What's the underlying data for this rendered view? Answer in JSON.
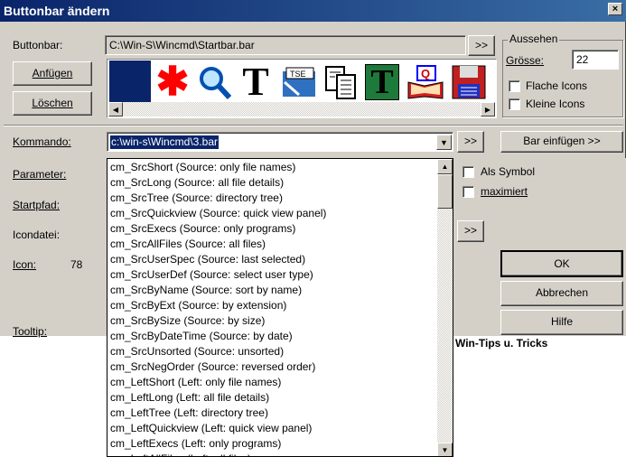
{
  "window": {
    "title": "Buttonbar ändern",
    "close": "×"
  },
  "buttonbar": {
    "label": "Buttonbar:",
    "path": "C:\\Win-S\\Wincmd\\Startbar.bar",
    "browse": ">>"
  },
  "buttons": {
    "append": "Anfügen",
    "delete": "Löschen",
    "ok": "OK",
    "cancel": "Abbrechen",
    "help": "Hilfe",
    "insert_bar": "Bar einfügen >>",
    "cmd_browse": ">>",
    "icon_browse": ">>"
  },
  "appearance": {
    "group": "Aussehen",
    "size_label": "Grösse:",
    "size_value": "22",
    "flat_icons": "Flache Icons",
    "small_icons": "Kleine Icons"
  },
  "fields": {
    "command_label": "Kommando:",
    "command_value": "c:\\win-s\\Wincmd\\3.bar",
    "parameter_label": "Parameter:",
    "startpath_label": "Startpfad:",
    "iconfile_label": "Icondatei:",
    "icon_label": "Icon:",
    "icon_number": "78",
    "tooltip_label": "Tooltip:"
  },
  "options": {
    "as_symbol": "Als Symbol",
    "maximized": "maximiert"
  },
  "background_text": "Win-Tips u. Tricks",
  "icons": [
    "blue-square-icon",
    "red-asterisk-icon",
    "magnifier-icon",
    "text-t-icon",
    "tse-icon",
    "copy-pages-icon",
    "green-t-icon",
    "book-q-icon",
    "floppy-disk-icon"
  ],
  "dropdown": {
    "items": [
      "cm_SrcShort (Source: only file names)",
      "cm_SrcLong (Source: all file details)",
      "cm_SrcTree (Source: directory tree)",
      "cm_SrcQuickview (Source: quick view panel)",
      "cm_SrcExecs (Source: only programs)",
      "cm_SrcAllFiles (Source: all files)",
      "cm_SrcUserSpec (Source: last selected)",
      "cm_SrcUserDef (Source: select user type)",
      "cm_SrcByName (Source: sort by name)",
      "cm_SrcByExt (Source: by extension)",
      "cm_SrcBySize (Source: by size)",
      "cm_SrcByDateTime (Source: by date)",
      "cm_SrcUnsorted (Source: unsorted)",
      "cm_SrcNegOrder (Source: reversed order)",
      "cm_LeftShort (Left: only file names)",
      "cm_LeftLong (Left: all file details)",
      "cm_LeftTree (Left: directory tree)",
      "cm_LeftQuickview (Left: quick view panel)",
      "cm_LeftExecs (Left: only programs)",
      "cm_LeftAllFiles (Left: all files)"
    ]
  }
}
